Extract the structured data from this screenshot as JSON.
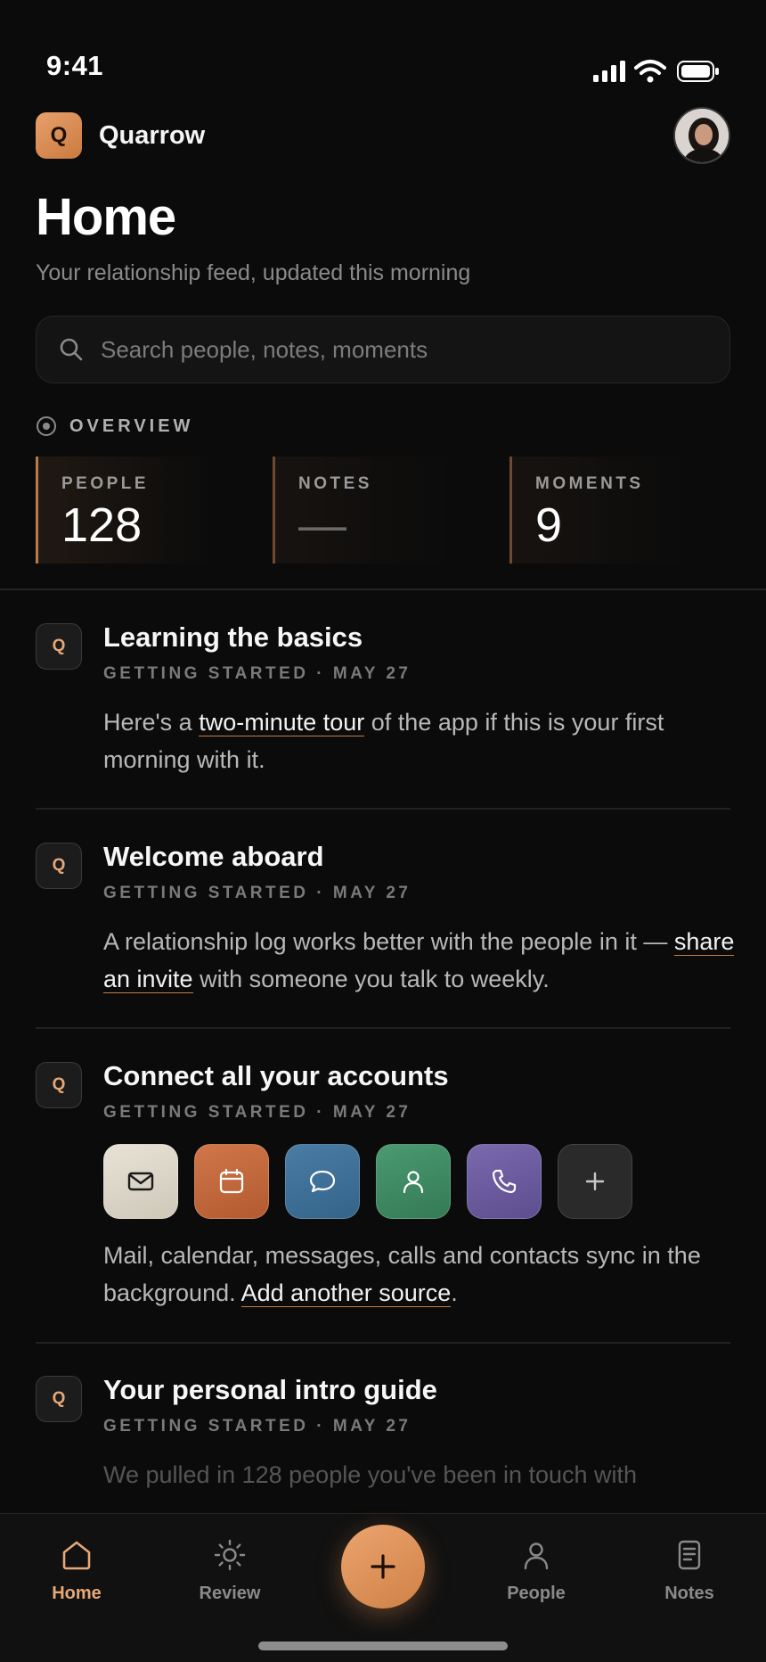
{
  "status_bar": {
    "time": "9:41"
  },
  "header": {
    "brand_initial": "Q",
    "brand_name": "Quarrow",
    "title": "Home",
    "subtitle": "Your relationship feed, updated this morning"
  },
  "search": {
    "placeholder": "Search people, notes, moments"
  },
  "overview": {
    "label": "OVERVIEW",
    "stats": [
      {
        "label": "PEOPLE",
        "value": "128"
      },
      {
        "label": "NOTES",
        "value": "—"
      },
      {
        "label": "MOMENTS",
        "value": "9"
      }
    ]
  },
  "feed": [
    {
      "icon": "Q",
      "title": "Learning the basics",
      "meta": "GETTING STARTED · MAY 27",
      "body_pre": "Here's a ",
      "link": "two-minute tour",
      "body_post": " of the app if this is your first morning with it."
    },
    {
      "icon": "Q",
      "title": "Welcome aboard",
      "meta": "GETTING STARTED · MAY 27",
      "body_pre": "A relationship log works better with the people in it — ",
      "link": "share an invite",
      "body_post": " with someone you talk to weekly."
    },
    {
      "icon": "Q",
      "title": "Connect all your accounts",
      "meta": "GETTING STARTED · MAY 27",
      "sources": [
        {
          "icon": "mail-icon",
          "color": "#e2dccf"
        },
        {
          "icon": "calendar-icon",
          "color": "#c8673a"
        },
        {
          "icon": "message-icon",
          "color": "#3f6f96"
        },
        {
          "icon": "contact-icon",
          "color": "#3e8a62"
        },
        {
          "icon": "phone-icon",
          "color": "#6c5b9e"
        },
        {
          "icon": "plus-icon",
          "color": "#2a2a2a"
        }
      ],
      "body_pre": "Mail, calendar, messages, calls and contacts sync in the background. ",
      "link": "Add another source",
      "body_post": "."
    },
    {
      "icon": "Q",
      "title": "Your personal intro guide",
      "meta": "GETTING STARTED · MAY 27",
      "body": "We pulled in 128 people you've been in touch with"
    }
  ],
  "tabbar": {
    "tabs": [
      {
        "label": "Home",
        "icon": "home-icon",
        "active": true
      },
      {
        "label": "Review",
        "icon": "sun-icon",
        "active": false
      },
      {
        "label": "People",
        "icon": "person-icon",
        "active": false
      },
      {
        "label": "Notes",
        "icon": "notes-icon",
        "active": false
      }
    ],
    "fab_icon": "plus-icon"
  },
  "colors": {
    "accent": "#e6a877",
    "background": "#0b0b0b"
  }
}
